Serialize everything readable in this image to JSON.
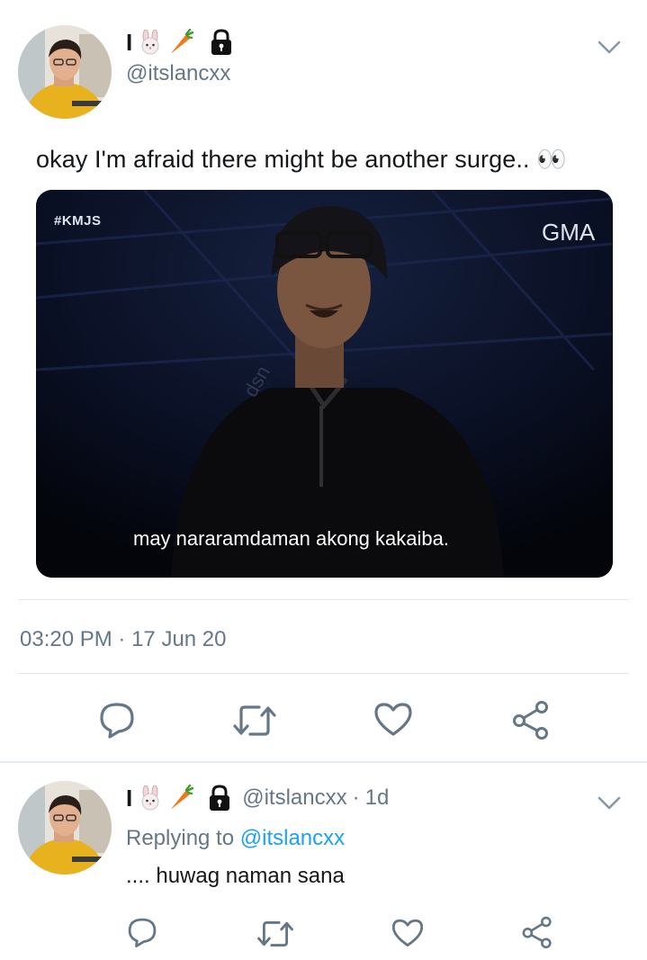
{
  "tweet": {
    "display_name_prefix": "I",
    "handle": "@itslancxx",
    "text": "okay I'm afraid there might be another surge.. 👀",
    "media": {
      "tag": "#KMJS",
      "network": "GMA",
      "watermark": "dsn",
      "caption": "may nararamdaman akong kakaiba."
    },
    "time": "03:20 PM",
    "date": "17 Jun 20"
  },
  "reply": {
    "display_name_prefix": "I",
    "handle": "@itslancxx",
    "age": "1d",
    "replying_to_label": "Replying to",
    "replying_to_handle": "@itslancxx",
    "text": ".... huwag naman sana"
  },
  "icons": [
    "rabbit-emoji-icon",
    "carrot-emoji-icon",
    "lock-icon",
    "chevron-down-icon",
    "reply-icon",
    "retweet-icon",
    "like-icon",
    "share-icon"
  ],
  "colors": {
    "text": "#14171a",
    "secondary": "#657786",
    "link": "#1da1f2",
    "divider": "#e1e8ed"
  }
}
